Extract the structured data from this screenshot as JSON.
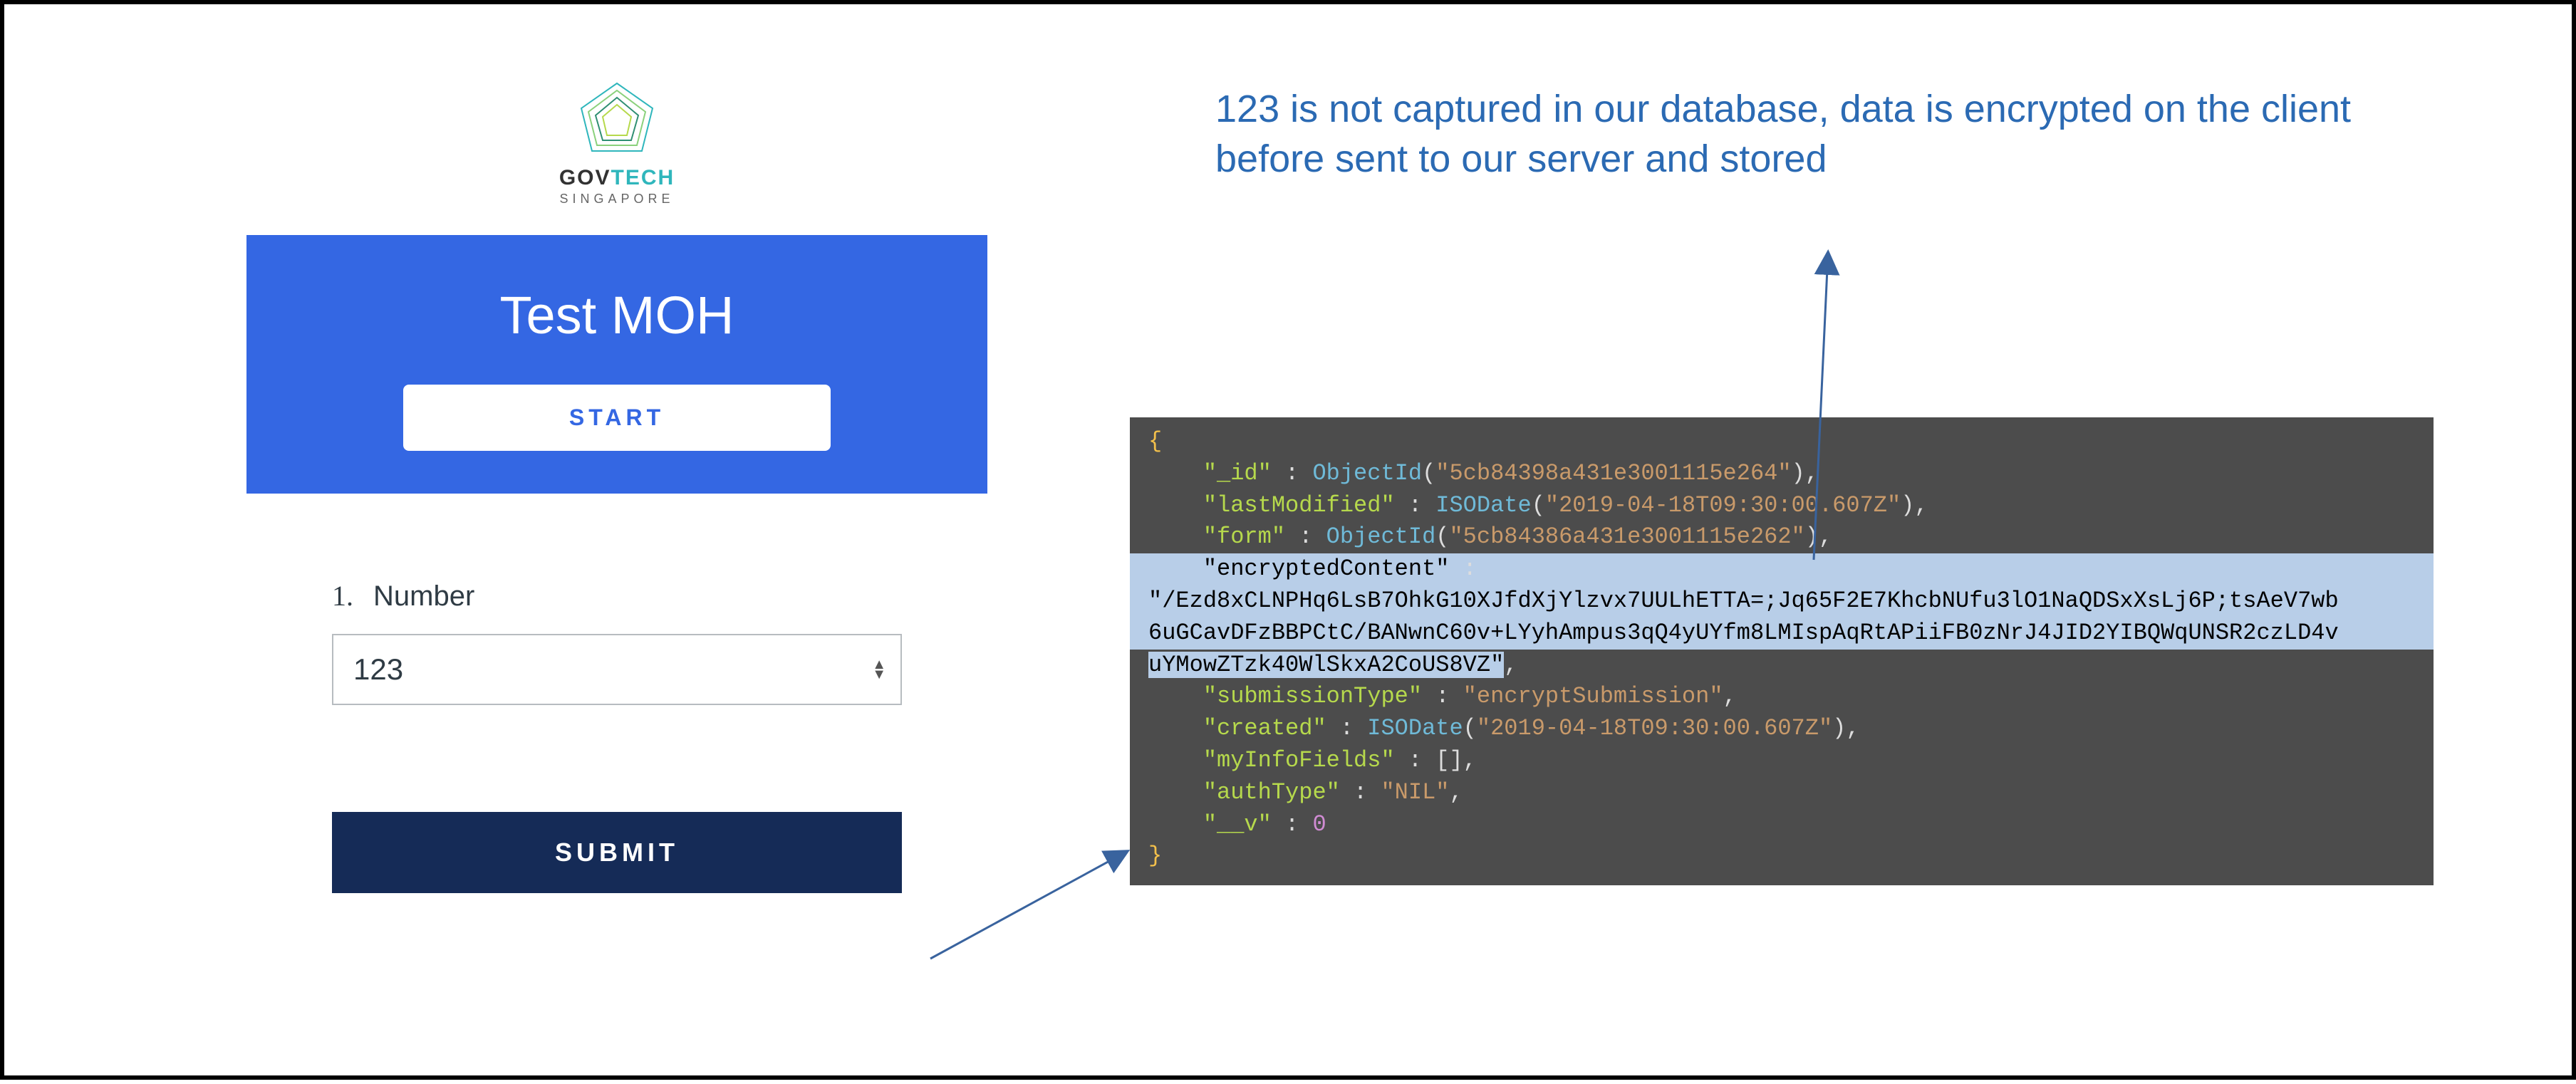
{
  "logo": {
    "gov": "GOV",
    "tech": "TECH",
    "sub": "SINGAPORE"
  },
  "hero": {
    "title": "Test MOH",
    "start": "START"
  },
  "question": {
    "number": "1.",
    "label": "Number",
    "value": "123"
  },
  "submit": "SUBMIT",
  "caption": "123 is not captured in our database, data is encrypted on the client before sent to our server and stored",
  "code": {
    "open_brace": "{",
    "id_key": "\"_id\"",
    "id_fn": "ObjectId",
    "id_val": "\"5cb84398a431e3001115e264\"",
    "lastModified_key": "\"lastModified\"",
    "iso_fn": "ISODate",
    "lastModified_val": "\"2019-04-18T09:30:00.607Z\"",
    "form_key": "\"form\"",
    "form_val": "\"5cb84386a431e3001115e262\"",
    "enc_key": "\"encryptedContent\"",
    "enc_line1": "\"/Ezd8xCLNPHq6LsB7OhkG10XJfdXjYlzvx7UULhETTA=;Jq65F2E7KhcbNUfu3lO1NaQDSxXsLj6P;tsAeV7wb",
    "enc_line2": "6uGCavDFzBBPCtC/BANwnC60v+LYyhAmpus3qQ4yUYfm8LMIspAqRtAPiiFB0zNrJ4JID2YIBQWqUNSR2czLD4v",
    "enc_line3": "uYMowZTzk40WlSkxA2CoUS8VZ\"",
    "subType_key": "\"submissionType\"",
    "subType_val": "\"encryptSubmission\"",
    "created_key": "\"created\"",
    "created_val": "\"2019-04-18T09:30:00.607Z\"",
    "myInfo_key": "\"myInfoFields\"",
    "authType_key": "\"authType\"",
    "authType_val": "\"NIL\"",
    "v_key": "\"__v\"",
    "v_val": "0",
    "close_brace": "}"
  }
}
